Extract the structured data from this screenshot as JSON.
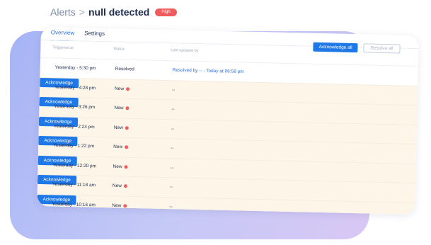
{
  "breadcrumb": {
    "root": "Alerts",
    "separator": ">",
    "title": "null detected",
    "severity": "High"
  },
  "tabs": [
    {
      "label": "Overview",
      "active": true
    },
    {
      "label": "Settings",
      "active": false
    }
  ],
  "actions": {
    "acknowledge_all": "Acknowledge all",
    "resolve_all": "Resolve all"
  },
  "columns": {
    "triggered": "Triggered at",
    "status": "Status",
    "updated": "Last updated by"
  },
  "rows": [
    {
      "time": "Yesterday - 5:30 pm",
      "status": "Resolved",
      "updated": "Resolved by -- - Today at 06:58 pm",
      "resolved": true
    },
    {
      "time": "Yesterday - 4:28 pm",
      "status": "New",
      "updated": "--",
      "action": "Acknowledge"
    },
    {
      "time": "Yesterday - 3:26 pm",
      "status": "New",
      "updated": "--",
      "action": "Acknowledge"
    },
    {
      "time": "Yesterday - 2:24 pm",
      "status": "New",
      "updated": "--",
      "action": "Acknowledge"
    },
    {
      "time": "Yesterday - 1:22 pm",
      "status": "New",
      "updated": "--",
      "action": "Acknowledge"
    },
    {
      "time": "Yesterday - 12:20 pm",
      "status": "New",
      "updated": "--",
      "action": "Acknowledge"
    },
    {
      "time": "Yesterday - 11:18 am",
      "status": "New",
      "updated": "--",
      "action": "Acknowledge"
    },
    {
      "time": "Yesterday - 10:16 am",
      "status": "New",
      "updated": "--",
      "action": "Acknowledge"
    }
  ],
  "colors": {
    "accent": "#1f78e8",
    "badge": "#f15b5b",
    "new_row_bg": "#fdf6e8"
  }
}
